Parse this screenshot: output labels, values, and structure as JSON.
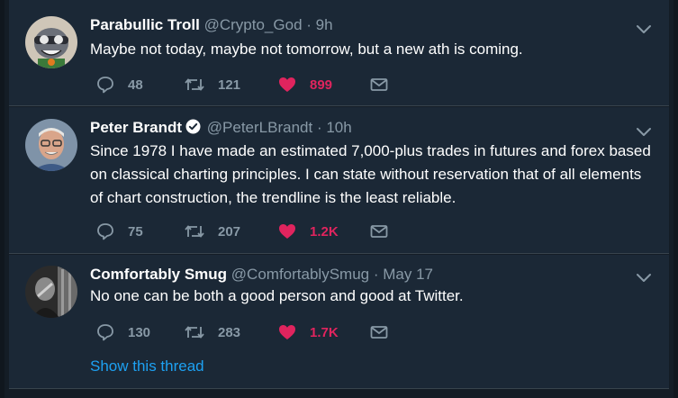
{
  "tweets": [
    {
      "name": "Parabullic Troll",
      "handle": "@Crypto_God",
      "separator": "·",
      "time": "9h",
      "verified": false,
      "text": "Maybe not today, maybe not tomorrow, but a new ath is coming.",
      "replies": "48",
      "retweets": "121",
      "likes": "899",
      "liked": true,
      "avatar": "cartoon-character-avatar"
    },
    {
      "name": "Peter Brandt",
      "handle": "@PeterLBrandt",
      "separator": "·",
      "time": "10h",
      "verified": true,
      "text": "Since 1978 I have made an estimated 7,000-plus trades in futures and forex based on classical charting principles. I can state without reservation that of all elements of chart construction, the trendline is the least reliable.",
      "replies": "75",
      "retweets": "207",
      "likes": "1.2K",
      "liked": true,
      "avatar": "man-with-glasses-avatar"
    },
    {
      "name": "Comfortably Smug",
      "handle": "@ComfortablySmug",
      "separator": "·",
      "time": "May 17",
      "verified": false,
      "text": "No one can be both a good person and good at Twitter.",
      "replies": "130",
      "retweets": "283",
      "likes": "1.7K",
      "liked": true,
      "avatar": "black-and-white-photo-avatar",
      "thread_link": "Show this thread"
    }
  ],
  "colors": {
    "background": "#141d26",
    "card": "#1b2836",
    "secondary_text": "#8899a6",
    "like": "#e0245e",
    "link": "#1da1f2"
  }
}
